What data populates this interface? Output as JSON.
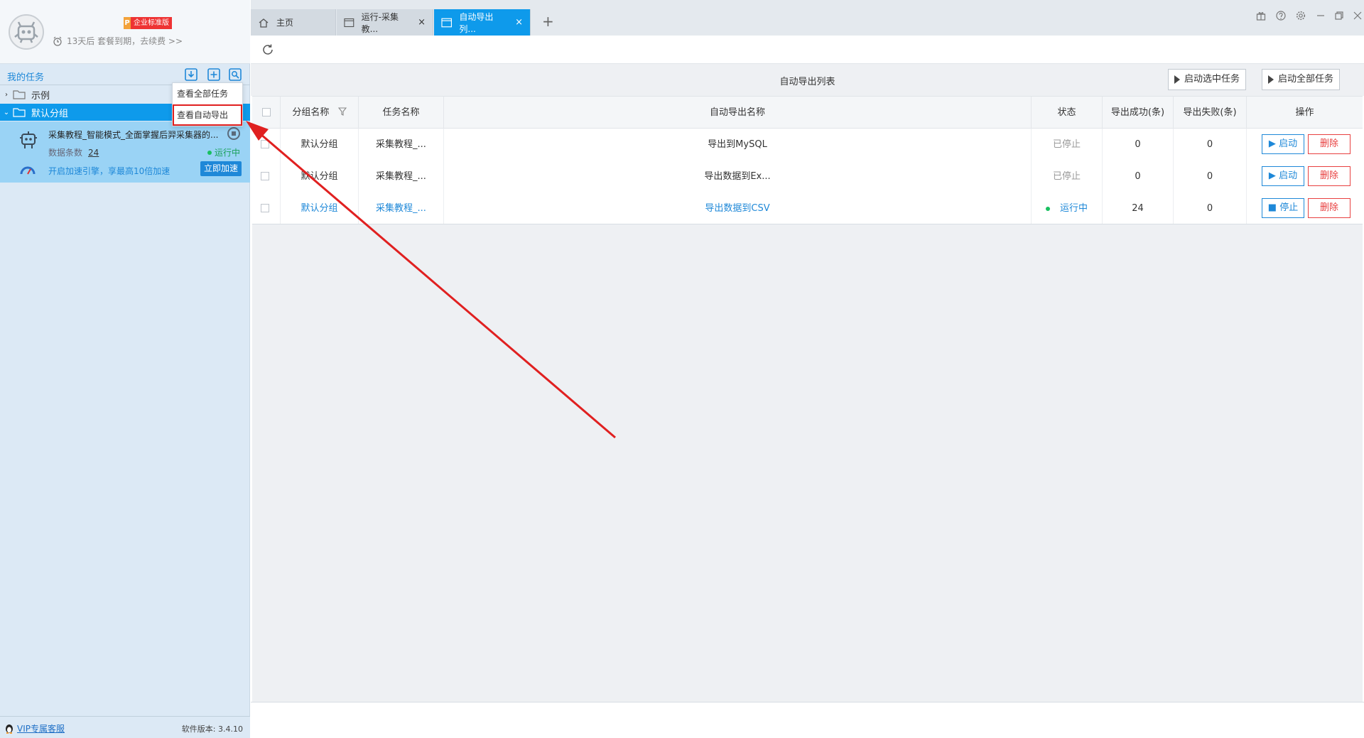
{
  "profile": {
    "edition_prefix": "P",
    "edition": "企业标准版",
    "expiry": "13天后 套餐到期，去续费 >>"
  },
  "sidebar": {
    "title": "我的任务",
    "tree": [
      {
        "label": "示例",
        "expanded": false,
        "selected": false
      },
      {
        "label": "默认分组",
        "expanded": true,
        "selected": true
      }
    ],
    "task": {
      "name": "采集教程_智能模式_全面掌握后羿采集器的...",
      "count_label": "数据条数",
      "count": "24",
      "status": "运行中",
      "accel_text": "开启加速引擎，享最高10倍加速",
      "accel_button": "立即加速"
    },
    "dropdown": [
      "查看全部任务",
      "查看自动导出"
    ],
    "footer": {
      "vip": "VIP专属客服",
      "version": "软件版本: 3.4.10"
    }
  },
  "tabs": [
    {
      "label": "主页",
      "icon": "home-icon"
    },
    {
      "label": "运行-采集教...",
      "icon": "window-icon",
      "close": "×"
    },
    {
      "label": "自动导出列...",
      "icon": "window-icon",
      "close": "×",
      "active": true
    }
  ],
  "add_tab": "+",
  "list": {
    "title": "自动导出列表",
    "start_selected": "启动选中任务",
    "start_all": "启动全部任务",
    "columns": [
      "分组名称",
      "任务名称",
      "自动导出名称",
      "状态",
      "导出成功(条)",
      "导出失败(条)",
      "操作"
    ],
    "rows": [
      {
        "group": "默认分组",
        "task": "采集教程_...",
        "export": "导出到MySQL",
        "status": "已停止",
        "running": false,
        "success": "0",
        "fail": "0",
        "action": "启动",
        "delete": "删除"
      },
      {
        "group": "默认分组",
        "task": "采集教程_...",
        "export": "导出数据到Ex...",
        "status": "已停止",
        "running": false,
        "success": "0",
        "fail": "0",
        "action": "启动",
        "delete": "删除"
      },
      {
        "group": "默认分组",
        "task": "采集教程_...",
        "export": "导出数据到CSV",
        "status": "运行中",
        "running": true,
        "success": "24",
        "fail": "0",
        "action": "停止",
        "delete": "删除"
      }
    ]
  },
  "colors": {
    "accent": "#0e9aeb",
    "link": "#1e88d8",
    "danger": "#e84040",
    "running": "#18c060",
    "annotation": "#e02020"
  }
}
